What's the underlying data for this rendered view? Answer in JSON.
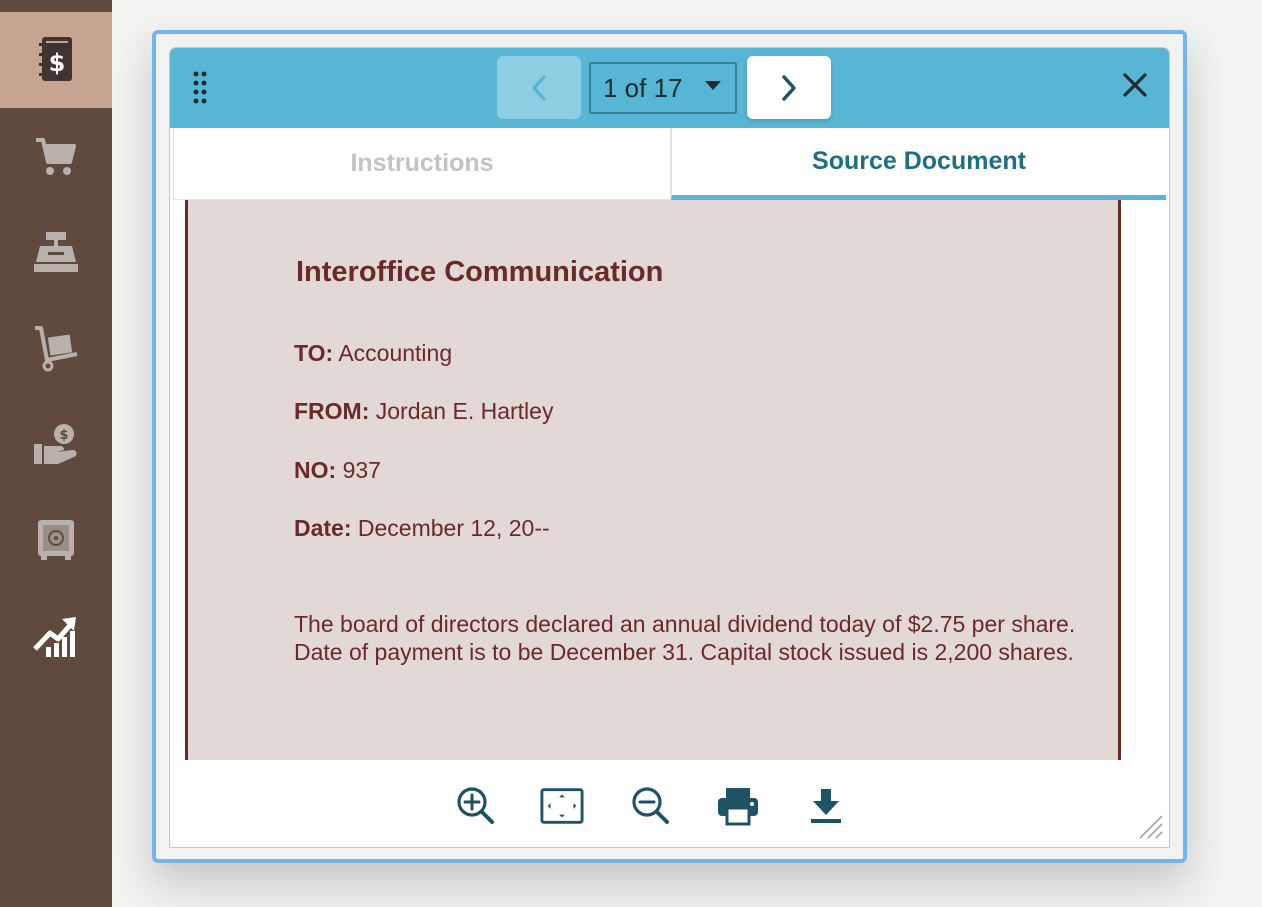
{
  "sidebar": {
    "items": [
      {
        "icon": "ledger-dollar-icon",
        "active": true
      },
      {
        "icon": "shopping-cart-icon",
        "active": false
      },
      {
        "icon": "cash-register-icon",
        "active": false
      },
      {
        "icon": "hand-truck-icon",
        "active": false
      },
      {
        "icon": "hand-coin-icon",
        "active": false
      },
      {
        "icon": "safe-icon",
        "active": false
      },
      {
        "icon": "growth-chart-icon",
        "active": false
      }
    ]
  },
  "dialog": {
    "page_selector": "1 of 17",
    "tabs": {
      "instructions": "Instructions",
      "source_document": "Source Document"
    },
    "active_tab": "Source Document"
  },
  "document": {
    "title": "Interoffice Communication",
    "to_label": "TO:",
    "to_value": "Accounting",
    "from_label": "FROM:",
    "from_value": "Jordan E. Hartley",
    "no_label": "NO:",
    "no_value": "937",
    "date_label": "Date:",
    "date_value": "December 12, 20--",
    "body": "The board of directors declared an annual dividend today of $2.75 per share. Date of payment is to be December 31. Capital stock issued is 2,200 shares."
  },
  "toolbar": {
    "tools": [
      "zoom-in-icon",
      "fit-to-screen-icon",
      "zoom-out-icon",
      "print-icon",
      "download-icon"
    ]
  },
  "colors": {
    "sidebar_bg": "#5f4a3d",
    "sidebar_active": "#c5a592",
    "header_bg": "#57b6d4",
    "doc_text": "#6b2a27",
    "doc_bg": "#e2d8d6",
    "tab_active_text": "#1e6f86",
    "toolbar_icon": "#1e5366"
  }
}
